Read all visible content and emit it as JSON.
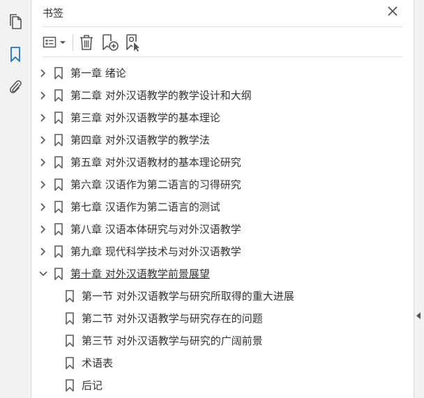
{
  "panel": {
    "title": "书签"
  },
  "bookmarks": [
    {
      "label": "第一章  绪论",
      "level": 0,
      "expanded": false
    },
    {
      "label": "第二章  对外汉语教学的教学设计和大纲",
      "level": 0,
      "expanded": false
    },
    {
      "label": "第三章  对外汉语教学的基本理论",
      "level": 0,
      "expanded": false
    },
    {
      "label": "第四章  对外汉语教学的教学法",
      "level": 0,
      "expanded": false
    },
    {
      "label": "第五章  对外汉语教材的基本理论研究",
      "level": 0,
      "expanded": false
    },
    {
      "label": "第六章  汉语作为第二语言的习得研究",
      "level": 0,
      "expanded": false
    },
    {
      "label": "第七章  汉语作为第二语言的测试",
      "level": 0,
      "expanded": false
    },
    {
      "label": "第八章  汉语本体研究与对外汉语教学",
      "level": 0,
      "expanded": false
    },
    {
      "label": "第九章  现代科学技术与对外汉语教学",
      "level": 0,
      "expanded": false
    },
    {
      "label": "第十章  对外汉语教学前景展望",
      "level": 0,
      "expanded": true
    },
    {
      "label": "第一节  对外汉语教学与研究所取得的重大进展",
      "level": 1
    },
    {
      "label": "第二节  对外汉语教学与研究存在的问题",
      "level": 1
    },
    {
      "label": "第三节  对外汉语教学与研究的广阔前景",
      "level": 1
    },
    {
      "label": "术语表",
      "level": 1
    },
    {
      "label": "后记",
      "level": 1
    }
  ],
  "colors": {
    "accent": "#1a73c9",
    "icon": "#555555",
    "text": "#333333"
  },
  "icons": {
    "rail": [
      "pages-icon",
      "bookmark-icon",
      "attachment-icon"
    ],
    "toolbar": [
      "options-menu-icon",
      "delete-icon",
      "new-bookmark-icon",
      "bookmark-from-selection-icon"
    ]
  }
}
